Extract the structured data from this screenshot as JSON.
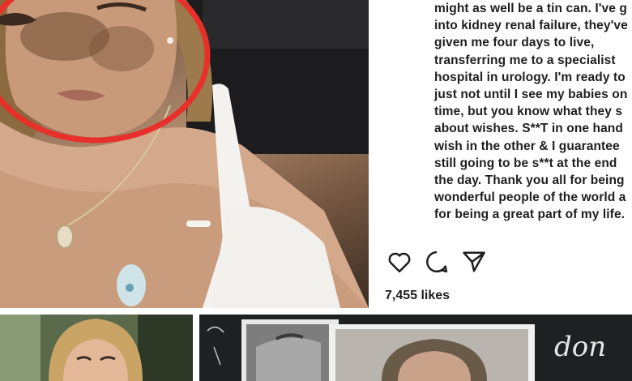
{
  "post": {
    "caption_lines": [
      "might as well be a tin can. I've g",
      "into kidney renal failure, they've",
      "given me four days to live,",
      "transferring me to a specialist",
      "hospital in urology. I'm ready to",
      "just not until I see my babies on",
      "time, but you know what they s",
      "about wishes. S**T in one hand",
      "wish in the other & I guarantee",
      "still going to be s**t at the end",
      "the day. Thank you all for being",
      "wonderful people of the world a",
      "for being a great part of my life."
    ],
    "likes": "7,455 likes"
  },
  "icons": {
    "like": "heart-icon",
    "comment": "comment-icon",
    "share": "send-icon"
  },
  "colors": {
    "highlight_circle": "#e8302a",
    "text": "#1e1e1e",
    "background": "#ffffff"
  },
  "overlay_text": {
    "chalk_word": "don"
  }
}
